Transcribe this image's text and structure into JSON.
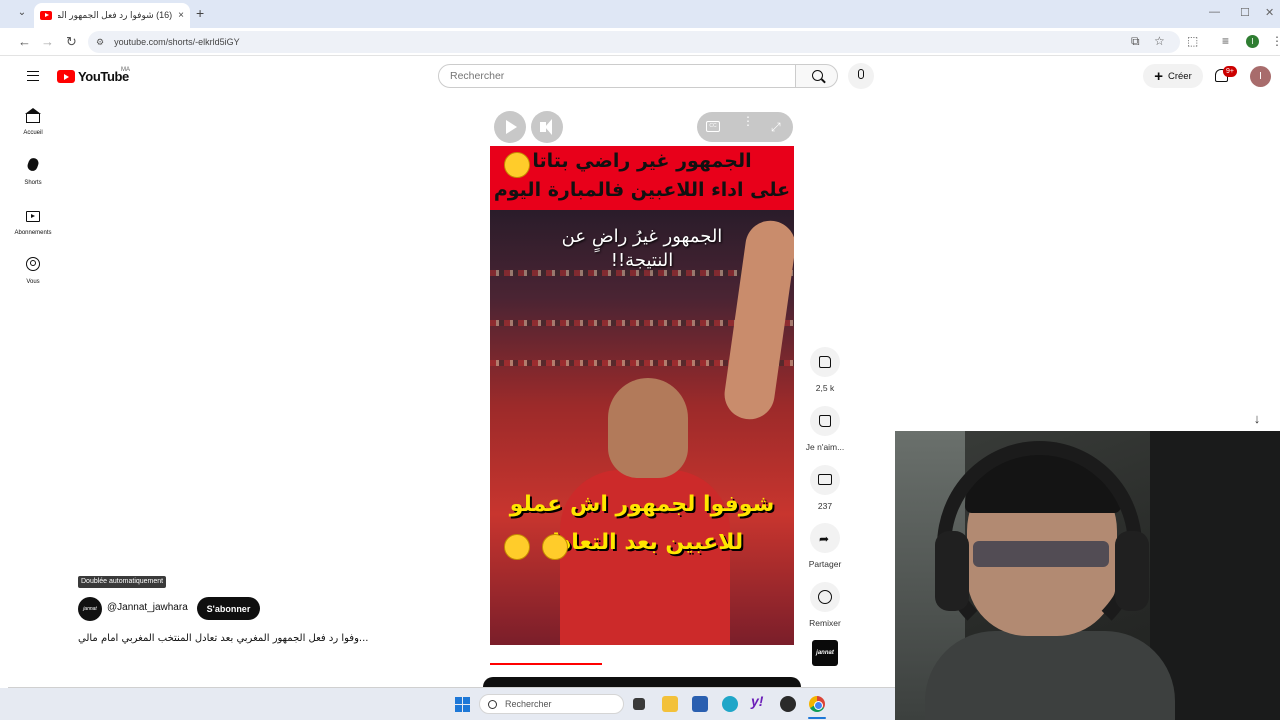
{
  "browser": {
    "tab_title": "(16) شوفوا رد فعل الجمهور المغر",
    "tab_close": "×",
    "new_tab": "+",
    "url": "youtube.com/shorts/-elkrld5iGY",
    "profile_initial": "I",
    "window_controls": [
      "—",
      "☐",
      "✕"
    ]
  },
  "youtube": {
    "logo_text": "YouTube",
    "region": "MA",
    "search_placeholder": "Rechercher",
    "create_label": "Créer",
    "notifications_badge": "9+",
    "avatar_initial": "I"
  },
  "sidebar": {
    "items": [
      {
        "label": "Accueil",
        "icon": "home-icon"
      },
      {
        "label": "Shorts",
        "icon": "shorts-icon"
      },
      {
        "label": "Abonnements",
        "icon": "subscriptions-icon"
      },
      {
        "label": "Vous",
        "icon": "you-icon"
      }
    ]
  },
  "video": {
    "banner_line1": "الجمهور غير راضي بتاتا",
    "banner_line2": "على اداء اللاعبين فالمبارة اليوم",
    "scene_caption_line1": "الجمهور غيرُ راضٍ عن",
    "scene_caption_line2": "النتيجة!!",
    "lower_caption_line1": "شوفوا لجمهور اش عملو",
    "lower_caption_line2": "للاعبين بعد التعادل",
    "dub_badge": "Doublée automatiquement",
    "channel_handle": "@Jannat_jawhara",
    "channel_avatar_text": "jannat",
    "subscribe_label": "S'abonner",
    "title": "...وفوا رد فعل الجمهور المغربي بعد تعادل المنتخب المغربي امام مالي",
    "progress_fraction": 0.37
  },
  "actions": {
    "like_count": "2,5 k",
    "dislike_label": "Je n'aim...",
    "comment_count": "237",
    "share_label": "Partager",
    "remix_label": "Remixer",
    "channel_thumb_text": "jannat"
  },
  "taskbar": {
    "search_placeholder": "Rechercher"
  },
  "colors": {
    "brand_red": "#ff0000",
    "banner_red": "#e8001a",
    "caption_yellow": "#ffe600",
    "subscribe_bg": "#0f0f0f",
    "windows_blue": "#1e78d7"
  }
}
